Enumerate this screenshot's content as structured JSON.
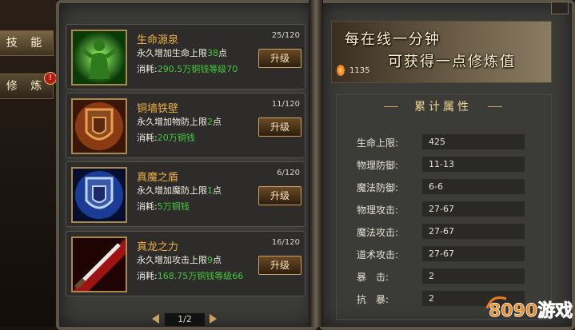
{
  "tabs": [
    {
      "label": "技 能",
      "active": true
    },
    {
      "label": "修 炼",
      "badge": "!"
    }
  ],
  "skills": [
    {
      "name": "生命源泉",
      "level": "25/120",
      "desc_prefix": "永久增加生命上限",
      "desc_value": "38",
      "desc_suffix": "点",
      "cost_prefix": "消耗:",
      "cost_value": "290.5万铜钱等级70",
      "button": "升级",
      "icon": "green-figure-icon"
    },
    {
      "name": "铜墙铁壁",
      "level": "11/120",
      "desc_prefix": "永久增加物防上限",
      "desc_value": "2",
      "desc_suffix": "点",
      "cost_prefix": "消耗:",
      "cost_value": "20万铜钱",
      "button": "升级",
      "icon": "bronze-shield-icon"
    },
    {
      "name": "真魔之盾",
      "level": "6/120",
      "desc_prefix": "永久增加魔防上限",
      "desc_value": "1",
      "desc_suffix": "点",
      "cost_prefix": "消耗:",
      "cost_value": "5万铜钱",
      "button": "升级",
      "icon": "blue-shield-icon"
    },
    {
      "name": "真龙之力",
      "level": "16/120",
      "desc_prefix": "永久增加攻击上限",
      "desc_value": "9",
      "desc_suffix": "点",
      "cost_prefix": "消耗:",
      "cost_value": "168.75万铜钱等级66",
      "button": "升级",
      "icon": "red-sword-icon"
    }
  ],
  "pager": {
    "text": "1/2"
  },
  "banner": {
    "line1": "每在线一分钟",
    "line2": "可获得一点修炼值",
    "points": "1135",
    "icon": "flame-icon"
  },
  "stats": {
    "title": "累计属性",
    "rows": [
      {
        "label": "生命上限:",
        "value": "425"
      },
      {
        "label": "物理防御:",
        "value": "11-13"
      },
      {
        "label": "魔法防御:",
        "value": "6-6"
      },
      {
        "label": "物理攻击:",
        "value": "27-67"
      },
      {
        "label": "魔法攻击:",
        "value": "27-67"
      },
      {
        "label": "道术攻击:",
        "value": "27-67"
      },
      {
        "label": "暴　击:",
        "value": "2"
      },
      {
        "label": "抗　暴:",
        "value": "2"
      }
    ]
  },
  "watermark": {
    "text": "8090游戏"
  },
  "colors": {
    "accent": "#f0b040",
    "highlight": "#44c93a",
    "panel": "#3b3b38"
  }
}
